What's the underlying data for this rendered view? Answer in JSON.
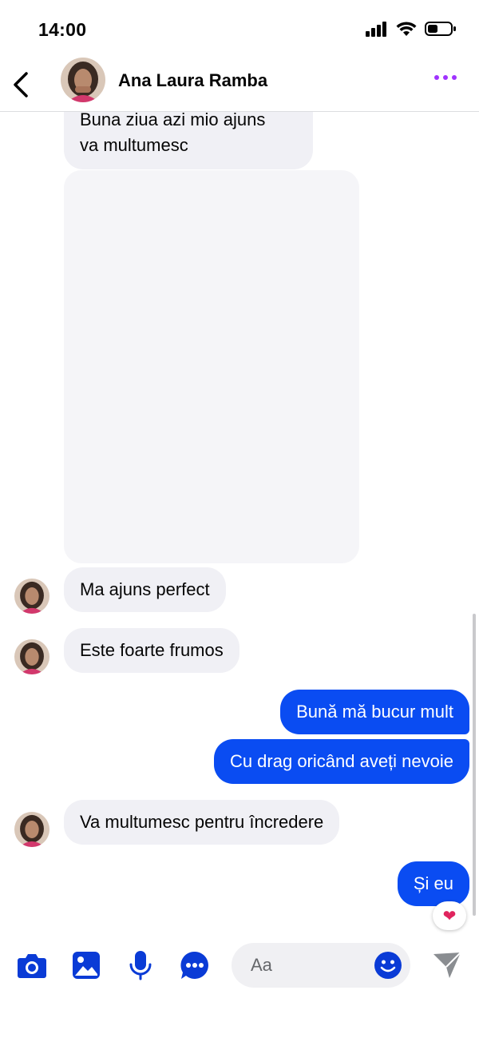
{
  "status_bar": {
    "time": "14:00"
  },
  "header": {
    "contact_name": "Ana Laura Ramba"
  },
  "messages": [
    {
      "direction": "incoming",
      "text_line1": "Buna ziua azi mio ajuns",
      "text_line2": "va multumesc"
    },
    {
      "direction": "incoming",
      "type": "media"
    },
    {
      "direction": "incoming",
      "text": "Ma ajuns perfect"
    },
    {
      "direction": "incoming",
      "text": "Este foarte frumos"
    },
    {
      "direction": "outgoing",
      "text": "Bună mă bucur mult"
    },
    {
      "direction": "outgoing",
      "text": "Cu drag oricând aveți nevoie"
    },
    {
      "direction": "incoming",
      "text": "Va multumesc pentru încredere"
    },
    {
      "direction": "outgoing",
      "text": "Și eu",
      "reaction": "❤"
    }
  ],
  "composer": {
    "placeholder": "Aa"
  },
  "colors": {
    "outgoing_bubble": "#0a4cf2",
    "incoming_bubble": "#f0f0f5",
    "accent_icon": "#0a3bd6",
    "menu_dots": "#a033ff"
  },
  "icons": [
    "back-icon",
    "more-dots-icon",
    "camera-icon",
    "gallery-icon",
    "microphone-icon",
    "chat-bubble-icon",
    "emoji-icon",
    "send-icon"
  ]
}
